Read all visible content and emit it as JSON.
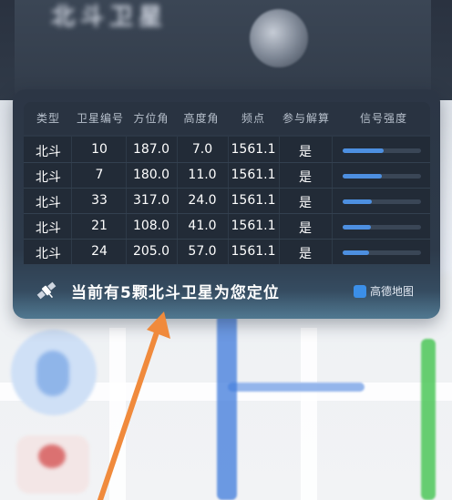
{
  "header": {
    "blurred_title": "北斗卫星"
  },
  "table": {
    "columns": [
      "类型",
      "卫星编号",
      "方位角",
      "高度角",
      "频点",
      "参与解算",
      "信号强度"
    ],
    "rows": [
      {
        "type": "北斗",
        "id": "10",
        "azimuth": "187.0",
        "elevation": "7.0",
        "freq": "1561.1",
        "used": "是",
        "signal": 0.52
      },
      {
        "type": "北斗",
        "id": "7",
        "azimuth": "180.0",
        "elevation": "11.0",
        "freq": "1561.1",
        "used": "是",
        "signal": 0.5
      },
      {
        "type": "北斗",
        "id": "33",
        "azimuth": "317.0",
        "elevation": "24.0",
        "freq": "1561.1",
        "used": "是",
        "signal": 0.37
      },
      {
        "type": "北斗",
        "id": "21",
        "azimuth": "108.0",
        "elevation": "41.0",
        "freq": "1561.1",
        "used": "是",
        "signal": 0.36
      },
      {
        "type": "北斗",
        "id": "24",
        "azimuth": "205.0",
        "elevation": "57.0",
        "freq": "1561.1",
        "used": "是",
        "signal": 0.34
      }
    ]
  },
  "footer": {
    "status": "当前有5颗北斗卫星为您定位",
    "brand": "高德地图"
  },
  "colors": {
    "signal_bar": "#4d8fe0",
    "arrow": "#f08a3c",
    "card_bg": "#2c3645"
  },
  "icons": {
    "satellite": "satellite-icon",
    "amap_logo": "amap-logo-icon"
  }
}
